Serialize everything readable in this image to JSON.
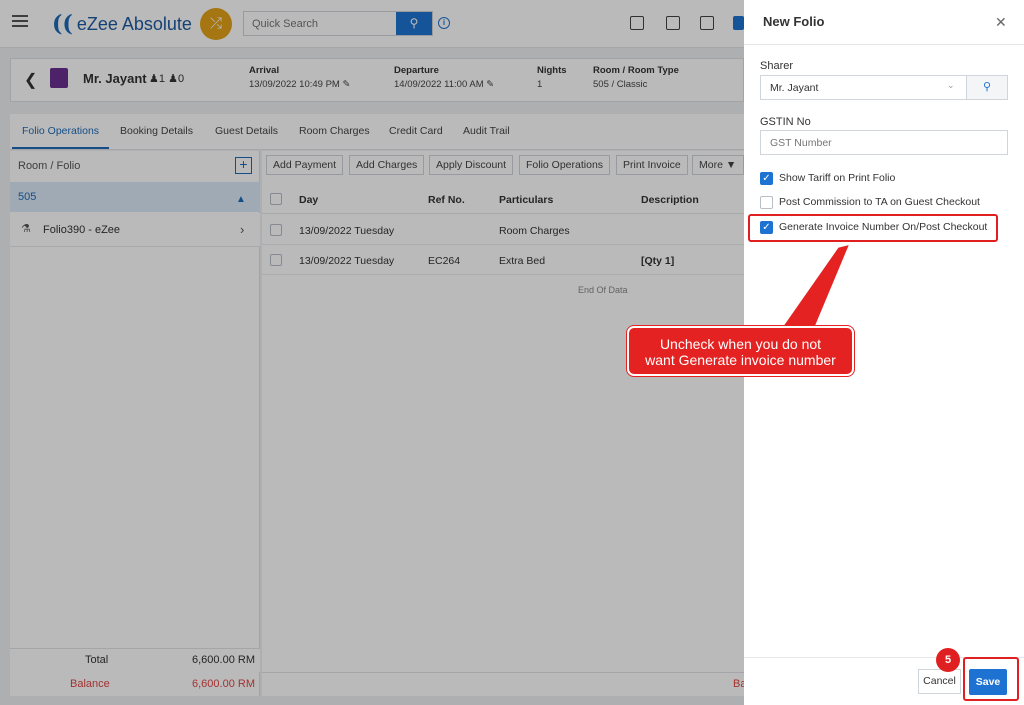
{
  "topbar": {
    "logo_text": "eZee Absolute",
    "search_placeholder": "Quick Search"
  },
  "booking": {
    "guest_name": "Mr. Jayant",
    "adults": "1",
    "children": "0",
    "arrival_label": "Arrival",
    "arrival_value": "13/09/2022 10:49 PM",
    "departure_label": "Departure",
    "departure_value": "14/09/2022 11:00 AM",
    "nights_label": "Nights",
    "nights_value": "1",
    "room_label": "Room / Room Type",
    "room_value": "505 / Classic"
  },
  "tabs": [
    "Folio Operations",
    "Booking Details",
    "Guest Details",
    "Room Charges",
    "Credit Card",
    "Audit Trail"
  ],
  "left_panel": {
    "title": "Room / Folio",
    "room": "505",
    "folio": "Folio390 - eZee",
    "total_label": "Total",
    "total_value": "6,600.00 RM",
    "balance_label": "Balance",
    "balance_value": "6,600.00 RM"
  },
  "actions": [
    "Add Payment",
    "Add Charges",
    "Apply Discount",
    "Folio Operations",
    "Print Invoice",
    "More"
  ],
  "grid": {
    "headers": [
      "Day",
      "Ref No.",
      "Particulars",
      "Description"
    ],
    "rows": [
      {
        "day": "13/09/2022 Tuesday",
        "ref": "",
        "particulars": "Room Charges",
        "description": ""
      },
      {
        "day": "13/09/2022 Tuesday",
        "ref": "EC264",
        "particulars": "Extra Bed",
        "description": "[Qty 1]"
      }
    ],
    "end_text": "End Of Data",
    "balance_cut": "Ba"
  },
  "drawer": {
    "title": "New Folio",
    "sharer_label": "Sharer",
    "sharer_value": "Mr. Jayant",
    "gstin_label": "GSTIN No",
    "gstin_placeholder": "GST Number",
    "options": [
      {
        "label": "Show Tariff on Print Folio",
        "checked": true
      },
      {
        "label": "Post Commission to TA on Guest Checkout",
        "checked": false
      },
      {
        "label": "Generate Invoice Number On/Post Checkout",
        "checked": true
      }
    ],
    "cancel_label": "Cancel",
    "save_label": "Save"
  },
  "annotation": {
    "callout_line1": "Uncheck when you do not",
    "callout_line2": "want Generate invoice number",
    "step": "5"
  },
  "colors": {
    "accent": "#1e73d2",
    "highlight": "#e02020",
    "brand_badge": "#e3a21a"
  }
}
